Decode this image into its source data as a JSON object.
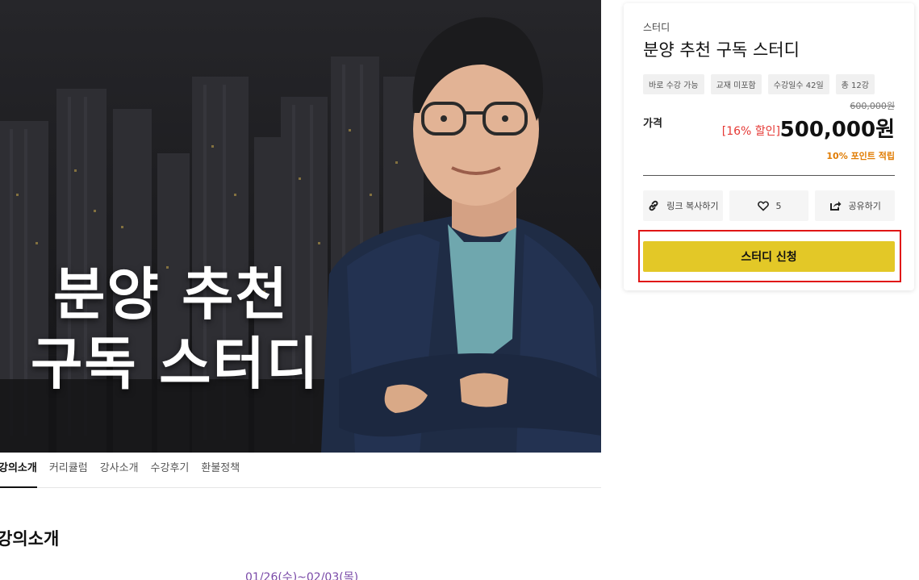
{
  "hero": {
    "title_line1": "분양 추천",
    "title_line2": "구독 스터디"
  },
  "tabs": [
    {
      "label": "강의소개",
      "active": true
    },
    {
      "label": "커리큘럼",
      "active": false
    },
    {
      "label": "강사소개",
      "active": false
    },
    {
      "label": "수강후기",
      "active": false
    },
    {
      "label": "환불정책",
      "active": false
    }
  ],
  "content": {
    "section_title": "강의소개",
    "date_line": "01/26(수)~02/03(목)"
  },
  "card": {
    "category": "스터디",
    "title": "분양 추천 구독 스터디",
    "chips": [
      "바로 수강 가능",
      "교재 미포함",
      "수강일수 42일",
      "총 12강"
    ],
    "price_label": "가격",
    "original_price": "600,000원",
    "discount": "[16% 할인]",
    "price": "500,000원",
    "points": "10% 포인트 적립",
    "actions": {
      "copy_link": "링크 복사하기",
      "like_count": "5",
      "share": "공유하기"
    },
    "apply_label": "스터디 신청"
  },
  "colors": {
    "accent_yellow": "#e3c827",
    "discount_red": "#e53935",
    "points_orange": "#e07b00",
    "highlight_red": "#e01515"
  },
  "icons": [
    "link-icon",
    "heart-icon",
    "share-icon"
  ]
}
